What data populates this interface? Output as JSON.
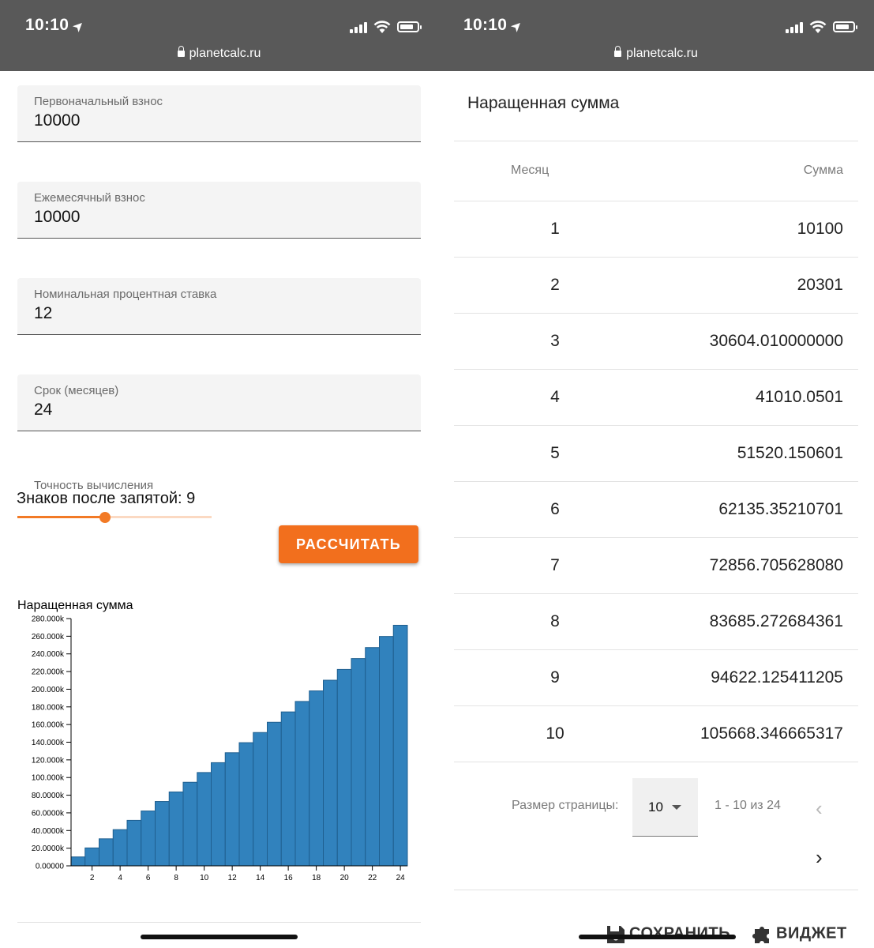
{
  "status_bar": {
    "time": "10:10",
    "url": "planetcalc.ru"
  },
  "left": {
    "fields": [
      {
        "label": "Первоначальный взнос",
        "value": "10000"
      },
      {
        "label": "Ежемесячный взнос",
        "value": "10000"
      },
      {
        "label": "Номинальная процентная ставка",
        "value": "12"
      },
      {
        "label": "Срок (месяцев)",
        "value": "24"
      }
    ],
    "precision": {
      "label": "Точность вычисления",
      "text": "Знаков после запятой: 9",
      "value": 9,
      "max": 20
    },
    "calculate_button": "РАССЧИТАТЬ"
  },
  "chart_data": {
    "type": "bar",
    "title": "Наращенная сумма",
    "xlabel": "",
    "ylabel": "",
    "x": [
      1,
      2,
      3,
      4,
      5,
      6,
      7,
      8,
      9,
      10,
      11,
      12,
      13,
      14,
      15,
      16,
      17,
      18,
      19,
      20,
      21,
      22,
      23,
      24
    ],
    "values": [
      10100,
      20301,
      30604.01,
      41010.05,
      51520.15,
      62135.35,
      72856.71,
      83685.27,
      94622.13,
      105668.35,
      116825.03,
      128093.28,
      139474.21,
      150968.95,
      162578.64,
      174304.43,
      186147.47,
      198108.95,
      210190.04,
      222391.94,
      234715.86,
      247163.02,
      259734.65,
      272431.99
    ],
    "ylim": [
      0,
      280000
    ],
    "yticks": [
      "0.00000",
      "20.0000k",
      "40.0000k",
      "60.0000k",
      "80.0000k",
      "100.000k",
      "120.000k",
      "140.000k",
      "160.000k",
      "180.000k",
      "200.000k",
      "220.000k",
      "240.000k",
      "260.000k",
      "280.000k"
    ],
    "xticks": [
      "2",
      "4",
      "6",
      "8",
      "10",
      "12",
      "14",
      "16",
      "18",
      "20",
      "22",
      "24"
    ],
    "bar_color": "#3182bd"
  },
  "right": {
    "title": "Наращенная сумма",
    "columns": {
      "month": "Месяц",
      "sum": "Сумма"
    },
    "rows": [
      {
        "month": "1",
        "sum": "10100"
      },
      {
        "month": "2",
        "sum": "20301"
      },
      {
        "month": "3",
        "sum": "30604.010000000"
      },
      {
        "month": "4",
        "sum": "41010.0501"
      },
      {
        "month": "5",
        "sum": "51520.150601"
      },
      {
        "month": "6",
        "sum": "62135.35210701"
      },
      {
        "month": "7",
        "sum": "72856.705628080"
      },
      {
        "month": "8",
        "sum": "83685.272684361"
      },
      {
        "month": "9",
        "sum": "94622.125411205"
      },
      {
        "month": "10",
        "sum": "105668.346665317"
      }
    ],
    "pager": {
      "size_label": "Размер страницы:",
      "size_value": "10",
      "range": "1 - 10 из 24"
    },
    "save_button": "СОХРАНИТЬ",
    "widget_button": "ВИДЖЕТ"
  },
  "colors": {
    "accent": "#f26f1d",
    "status_bar": "#595959",
    "bar": "#3182bd"
  }
}
